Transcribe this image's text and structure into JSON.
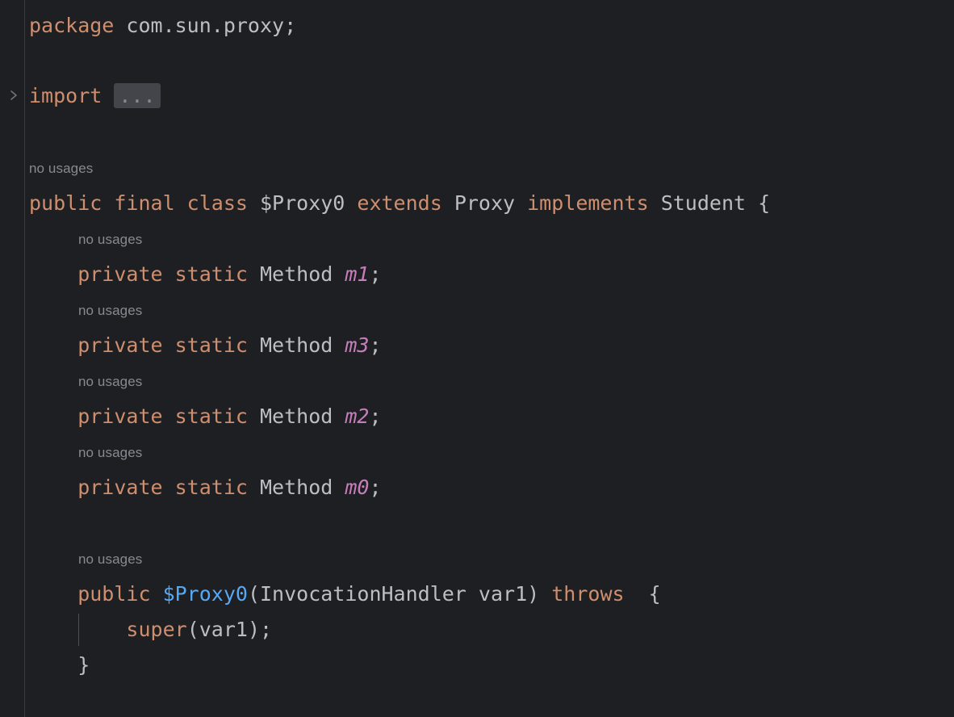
{
  "editor": {
    "language": "java",
    "background": "#1e1f22",
    "gutter_background": "#1e1f22",
    "gutter_separator_color": "#393b40",
    "default_text_color": "#bcbec4",
    "keyword_color": "#cf8e6d",
    "field_color": "#c77dbb",
    "constructor_color": "#56a8f5",
    "inlay_hint_color": "#868a91",
    "fold_placeholder_background": "#43454a"
  },
  "gutter": {
    "fold_marker_icon": "chevron-right-icon",
    "fold_marker_tooltip": "Expand import block"
  },
  "inlay_hints": {
    "no_usages": "no usages"
  },
  "fold": {
    "import_placeholder": "..."
  },
  "code": {
    "line_package": {
      "keyword": "package",
      "space": " ",
      "name": "com.sun.proxy;"
    },
    "line_import": {
      "keyword": "import",
      "space": " "
    },
    "line_class": {
      "modifiers": "public final class ",
      "class_name": "$Proxy0",
      "extends_kw": " extends ",
      "super_class": "Proxy",
      "implements_kw": " implements ",
      "interface_name": "Student",
      "brace": " {"
    },
    "fields": [
      {
        "modifiers": "    private static ",
        "type": "Method ",
        "name": "m1",
        "semi": ";"
      },
      {
        "modifiers": "    private static ",
        "type": "Method ",
        "name": "m3",
        "semi": ";"
      },
      {
        "modifiers": "    private static ",
        "type": "Method ",
        "name": "m2",
        "semi": ";"
      },
      {
        "modifiers": "    private static ",
        "type": "Method ",
        "name": "m0",
        "semi": ";"
      }
    ],
    "constructor": {
      "modifier": "    public ",
      "name": "$Proxy0",
      "params": "(InvocationHandler var1) ",
      "throws_kw": "throws",
      "brace": "  {"
    },
    "super_call": {
      "indent": "        ",
      "keyword": "super",
      "args": "(var1);"
    },
    "closing_brace": "    }"
  }
}
